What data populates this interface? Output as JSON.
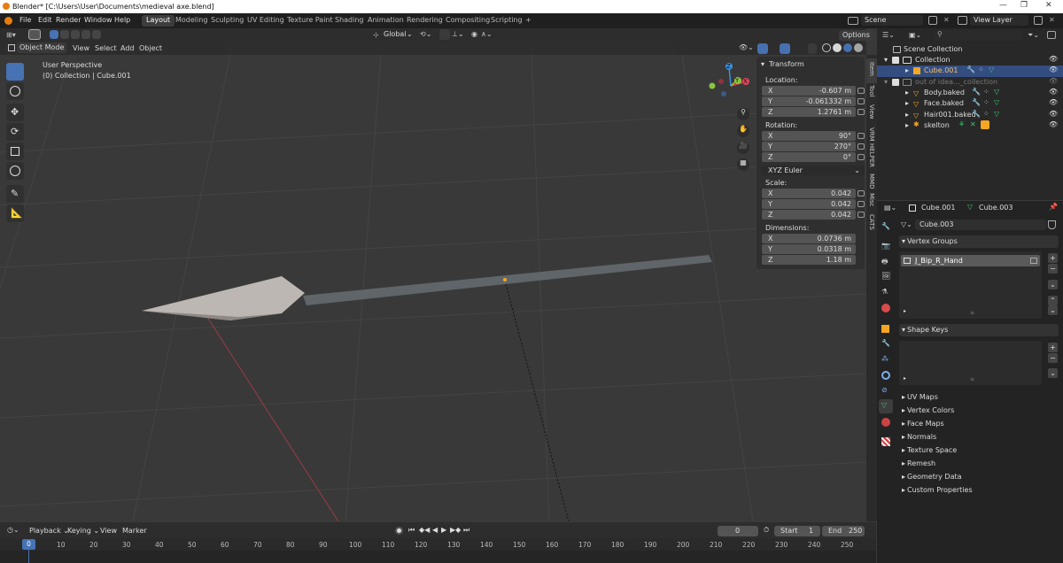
{
  "title": "Blender* [C:\\Users\\User\\Documents\\medieval axe.blend]",
  "window_controls": [
    "—",
    "❐",
    "✕"
  ],
  "menus": [
    "File",
    "Edit",
    "Render",
    "Window",
    "Help"
  ],
  "workspaces": [
    "Layout",
    "Modeling",
    "Sculpting",
    "UV Editing",
    "Texture Paint",
    "Shading",
    "Animation",
    "Rendering",
    "Compositing",
    "Scripting",
    "+"
  ],
  "scene": "Scene",
  "view_layer": "View Layer",
  "header": {
    "transform_orientation": "Global",
    "options": "Options"
  },
  "viewport_header": {
    "mode": "Object Mode",
    "menus": [
      "View",
      "Select",
      "Add",
      "Object"
    ]
  },
  "viewport": {
    "perspective": "User Perspective",
    "collection_info": "(0) Collection | Cube.001"
  },
  "gizmo": {
    "z": "Z",
    "x": "X",
    "y": "Y"
  },
  "transform": {
    "title": "Transform",
    "location_label": "Location:",
    "location": [
      {
        "axis": "X",
        "value": "-0.607 m"
      },
      {
        "axis": "Y",
        "value": "-0.061332 m"
      },
      {
        "axis": "Z",
        "value": "1.2761 m"
      }
    ],
    "rotation_label": "Rotation:",
    "rotation": [
      {
        "axis": "X",
        "value": "90°"
      },
      {
        "axis": "Y",
        "value": "270°"
      },
      {
        "axis": "Z",
        "value": "0°"
      }
    ],
    "rotation_mode": "XYZ Euler",
    "scale_label": "Scale:",
    "scale": [
      {
        "axis": "X",
        "value": "0.042"
      },
      {
        "axis": "Y",
        "value": "0.042"
      },
      {
        "axis": "Z",
        "value": "0.042"
      }
    ],
    "dimensions_label": "Dimensions:",
    "dimensions": [
      {
        "axis": "X",
        "value": "0.0736 m"
      },
      {
        "axis": "Y",
        "value": "0.0318 m"
      },
      {
        "axis": "Z",
        "value": "1.18 m"
      }
    ]
  },
  "sidebar_tabs": [
    "Item",
    "Tool",
    "View",
    "VRM HELPER",
    "MMD",
    "Misc",
    "CATS"
  ],
  "outliner": {
    "root": "Scene Collection",
    "rows": [
      {
        "name": "Collection",
        "indent": 1
      },
      {
        "name": "Cube.001",
        "indent": 2
      },
      {
        "name": "out of idea..._collection",
        "indent": 1
      },
      {
        "name": "Body.baked",
        "indent": 2
      },
      {
        "name": "Face.baked",
        "indent": 2
      },
      {
        "name": "Hair001.baked",
        "indent": 2
      },
      {
        "name": "skelton",
        "indent": 2
      }
    ]
  },
  "properties": {
    "object": "Cube.001",
    "mesh": "Cube.003",
    "data_name": "Cube.003",
    "vertex_groups_title": "Vertex Groups",
    "vertex_group_item": "J_Bip_R_Hand",
    "shape_keys_title": "Shape Keys",
    "collapsed_panels": [
      "UV Maps",
      "Vertex Colors",
      "Face Maps",
      "Normals",
      "Texture Space",
      "Remesh",
      "Geometry Data",
      "Custom Properties"
    ]
  },
  "timeline": {
    "menus": [
      "Playback",
      "Keying",
      "View",
      "Marker"
    ],
    "current_frame": "0",
    "start_label": "Start",
    "start": "1",
    "end_label": "End",
    "end": "250",
    "ticks": [
      "0",
      "10",
      "20",
      "30",
      "40",
      "50",
      "60",
      "70",
      "80",
      "90",
      "100",
      "110",
      "120",
      "130",
      "140",
      "150",
      "160",
      "170",
      "180",
      "190",
      "200",
      "210",
      "220",
      "230",
      "240",
      "250"
    ]
  },
  "colors": {
    "accent": "#4772b3",
    "selected_orange": "#f5a623",
    "x_axis": "#e2465b",
    "y_axis": "#8bc53f",
    "z_axis": "#3a8fdc"
  }
}
